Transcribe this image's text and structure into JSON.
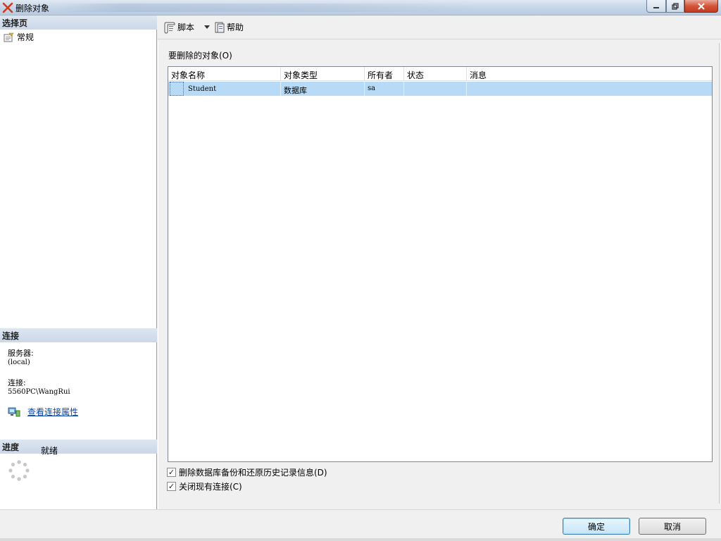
{
  "window": {
    "title": "删除对象"
  },
  "left_pane": {
    "select_page_header": "选择页",
    "nav_items": [
      {
        "label": "常规",
        "icon": "general-page-icon"
      }
    ],
    "connection_header": "连接",
    "server_label": "服务器:",
    "server_value": "(local)",
    "connection_label": "连接:",
    "connection_value": "5560PC\\WangRui",
    "view_connection_properties": "查看连接属性",
    "progress_header": "进度",
    "progress_status": "就绪"
  },
  "toolbar": {
    "script_label": "脚本",
    "help_label": "帮助"
  },
  "objects": {
    "label": "要删除的对象(O)",
    "columns": [
      "对象名称",
      "对象类型",
      "所有者",
      "状态",
      "消息"
    ],
    "rows": [
      {
        "name": "Student",
        "type": "数据库",
        "owner": "sa",
        "status": "",
        "message": ""
      }
    ]
  },
  "options": {
    "delete_backup_history": {
      "label": "删除数据库备份和还原历史记录信息(D)",
      "checked": true
    },
    "close_connections": {
      "label": "关闭现有连接(C)",
      "checked": true
    }
  },
  "buttons": {
    "ok": "确定",
    "cancel": "取消"
  },
  "colors": {
    "selected_row": "#b7dbf7",
    "link": "#0645ad",
    "section_header": "#d3dfec"
  }
}
